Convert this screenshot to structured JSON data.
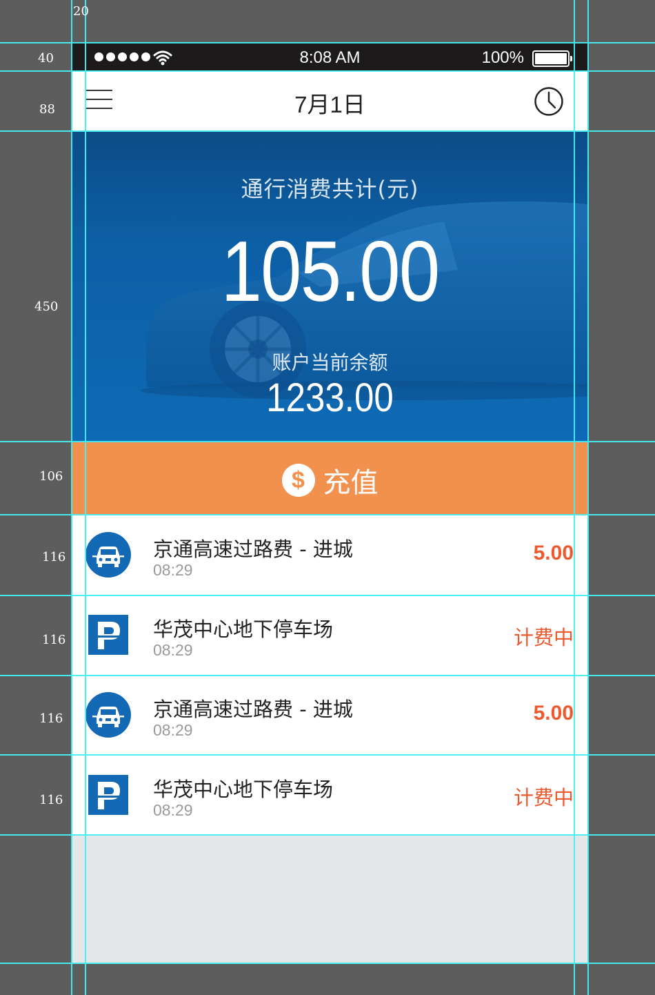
{
  "annotations": [
    "20",
    "40",
    "88",
    "450",
    "106",
    "116",
    "116",
    "116",
    "116"
  ],
  "status_bar": {
    "time": "8:08 AM",
    "battery": "100%"
  },
  "nav": {
    "title": "7月1日"
  },
  "hero": {
    "label": "通行消费共计(元)",
    "amount": "105.00",
    "balance_label": "账户当前余额",
    "balance": "1233.00"
  },
  "recharge": {
    "label": "充值",
    "icon_glyph": "$"
  },
  "transactions": [
    {
      "icon": "car-icon",
      "title": "京通高速过路费 - 进城",
      "time": "08:29",
      "amount": "5.00"
    },
    {
      "icon": "parking-icon",
      "title": "华茂中心地下停车场",
      "time": "08:29",
      "status": "计费中"
    },
    {
      "icon": "car-icon",
      "title": "京通高速过路费 - 进城",
      "time": "08:29",
      "amount": "5.00"
    },
    {
      "icon": "parking-icon",
      "title": "华茂中心地下停车场",
      "time": "08:29",
      "status": "计费中"
    }
  ],
  "colors": {
    "hero": "#0e6ab5",
    "accent": "#f2914e",
    "amount": "#ee5a2f",
    "guide": "#43f0f3"
  }
}
